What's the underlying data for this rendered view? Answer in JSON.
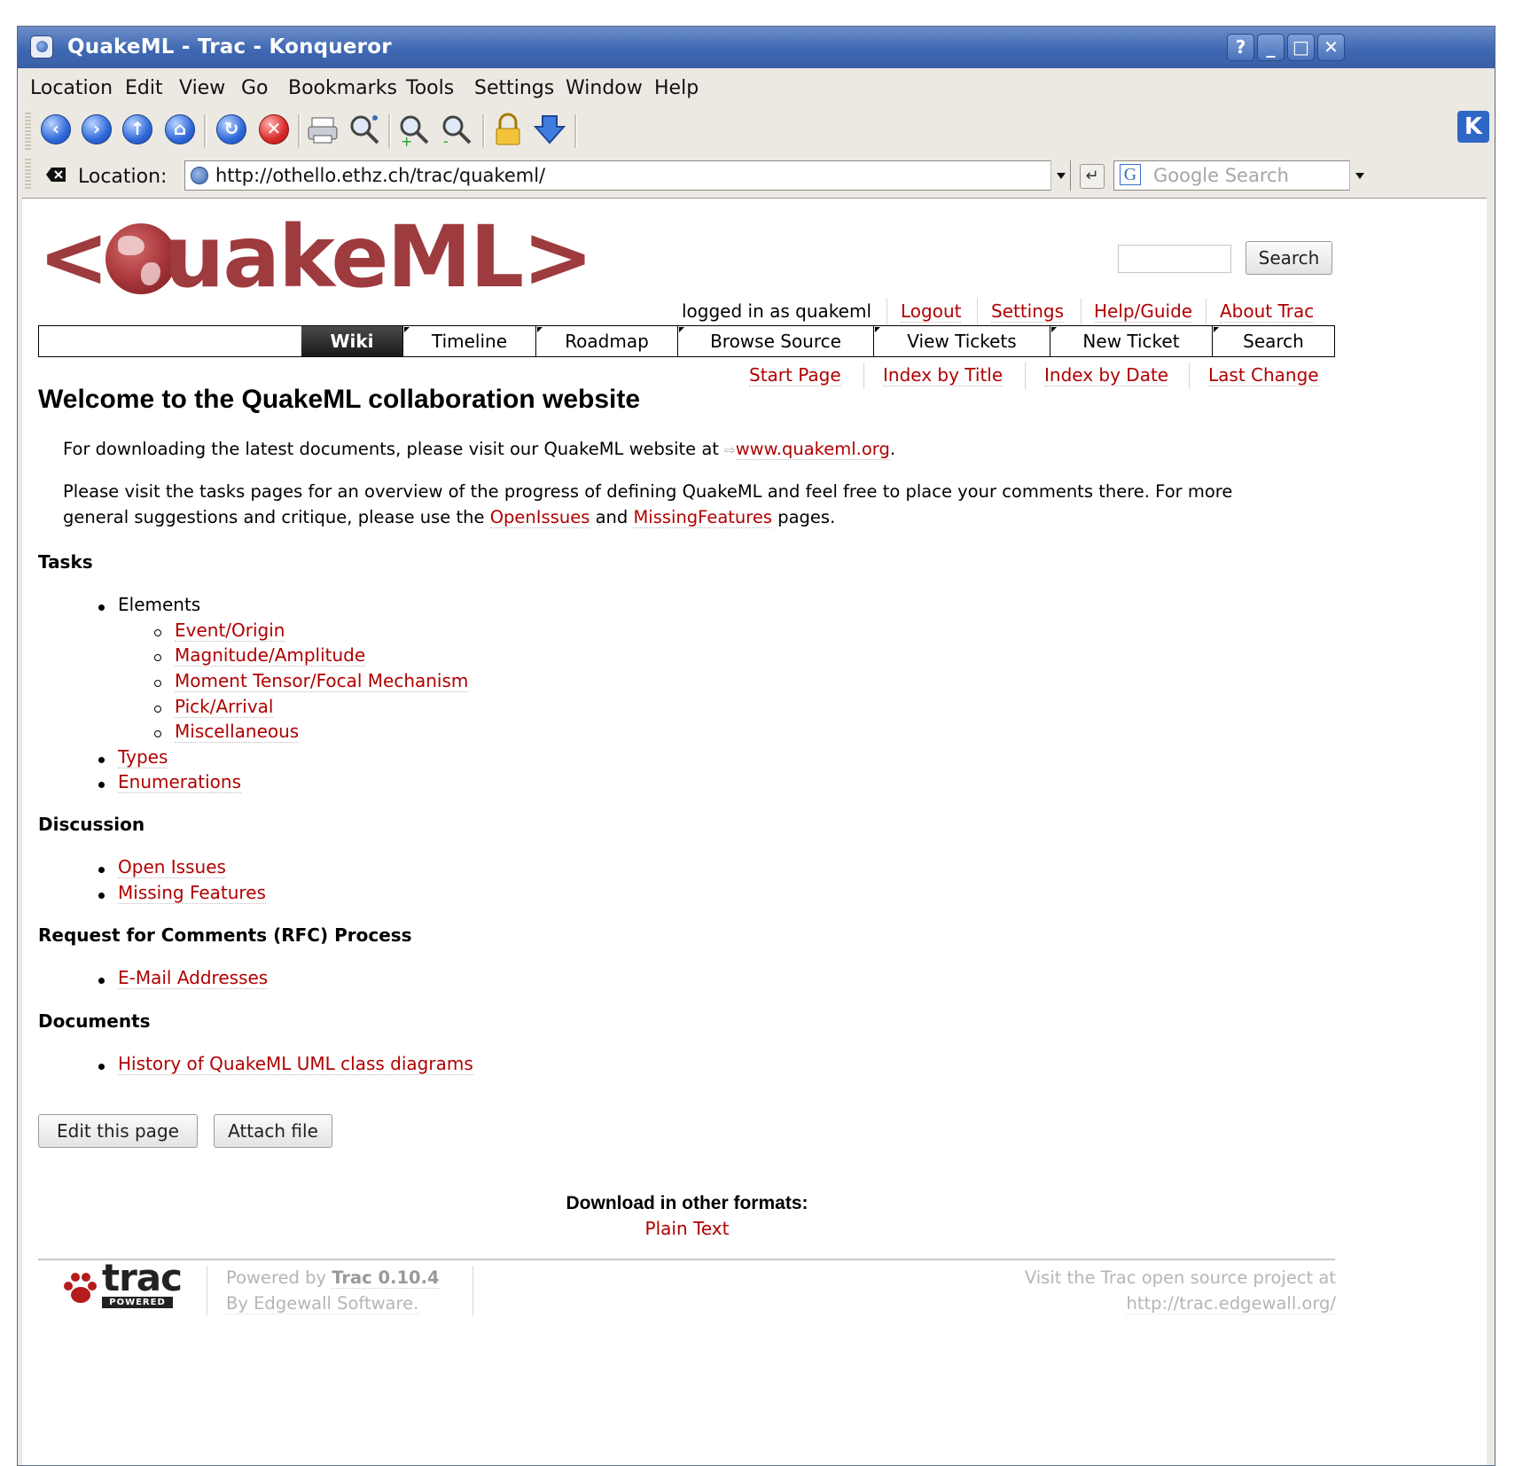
{
  "window": {
    "title": "QuakeML - Trac - Konqueror"
  },
  "menu": [
    "Location",
    "Edit",
    "View",
    "Go",
    "Bookmarks",
    "Tools",
    "Settings",
    "Window",
    "Help"
  ],
  "location_bar": {
    "label": "Location:",
    "url": "http://othello.ethz.ch/trac/quakeml/",
    "search_placeholder": "Google Search"
  },
  "header": {
    "logo_text_left": "<",
    "logo_text_right": "uakeML>",
    "search_button": "Search"
  },
  "metanav": {
    "logged_in": "logged in as quakeml",
    "links": [
      "Logout",
      "Settings",
      "Help/Guide",
      "About Trac"
    ]
  },
  "mainnav": [
    "Wiki",
    "Timeline",
    "Roadmap",
    "Browse Source",
    "View Tickets",
    "New Ticket",
    "Search"
  ],
  "ctxnav": [
    "Start Page",
    "Index by Title",
    "Index by Date",
    "Last Change"
  ],
  "page": {
    "title": "Welcome to the QuakeML collaboration website",
    "p1_text": "For downloading the latest documents, please visit our QuakeML website at ",
    "p1_link": "www.quakeml.org",
    "p1_end": ".",
    "p2_text_a": "Please visit the tasks pages for an overview of the progress of defining QuakeML and feel free to place your comments there. For more",
    "p2_text_b": "general suggestions and critique, please use the ",
    "p2_link1": "OpenIssues",
    "p2_and": " and ",
    "p2_link2": "MissingFeatures",
    "p2_end": " pages.",
    "tasks_heading": "Tasks",
    "elements_label": "Elements",
    "elements": [
      "Event/Origin",
      "Magnitude/Amplitude",
      "Moment Tensor/Focal Mechanism",
      "Pick/Arrival",
      "Miscellaneous"
    ],
    "task_links": [
      "Types",
      "Enumerations"
    ],
    "discussion_heading": "Discussion",
    "discussion": [
      "Open Issues",
      "Missing Features"
    ],
    "rfc_heading": "Request for Comments (RFC) Process",
    "rfc": [
      "E-Mail Addresses"
    ],
    "documents_heading": "Documents",
    "documents": [
      "History of QuakeML UML class diagrams"
    ],
    "edit_button": "Edit this page",
    "attach_button": "Attach file",
    "download_heading": "Download in other formats:",
    "download_link": "Plain Text"
  },
  "footer": {
    "logo_text": "trac",
    "logo_sub": "POWERED",
    "powered_by": "Powered by ",
    "trac_version": "Trac 0.10.4",
    "by_edgewall": "By Edgewall Software.",
    "visit_text": "Visit the Trac open source project at",
    "visit_url": "http://trac.edgewall.org/"
  }
}
